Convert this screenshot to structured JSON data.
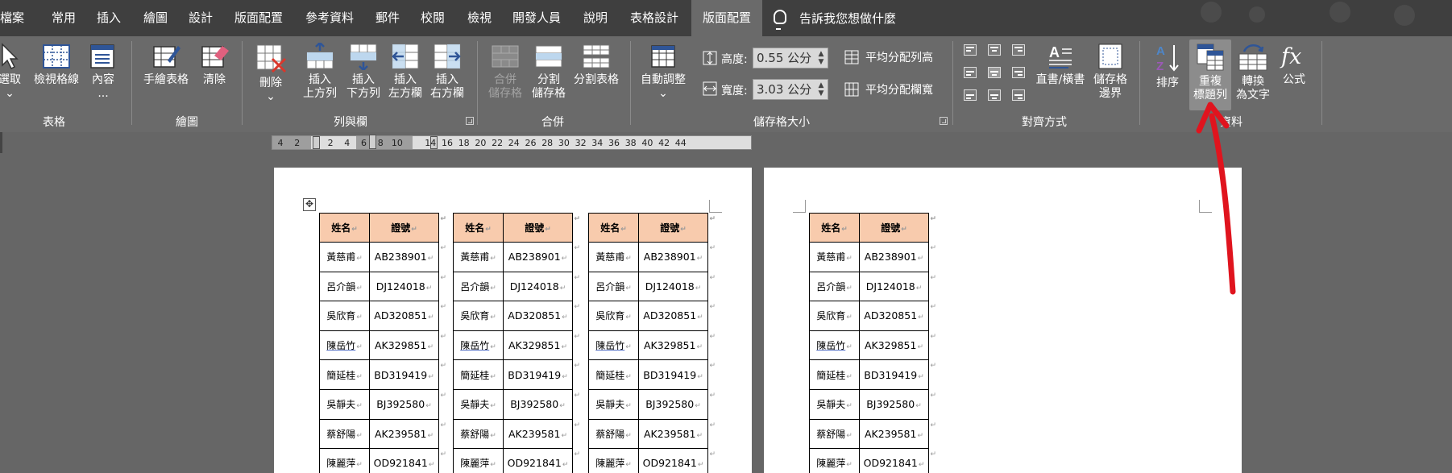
{
  "tabs": [
    {
      "label": "檔案",
      "active": false
    },
    {
      "label": "常用",
      "active": false
    },
    {
      "label": "插入",
      "active": false
    },
    {
      "label": "繪圖",
      "active": false
    },
    {
      "label": "設計",
      "active": false
    },
    {
      "label": "版面配置",
      "active": false
    },
    {
      "label": "參考資料",
      "active": false
    },
    {
      "label": "郵件",
      "active": false
    },
    {
      "label": "校閱",
      "active": false
    },
    {
      "label": "檢視",
      "active": false
    },
    {
      "label": "開發人員",
      "active": false
    },
    {
      "label": "說明",
      "active": false
    },
    {
      "label": "表格設計",
      "active": false
    },
    {
      "label": "版面配置",
      "active": true
    }
  ],
  "tell_me": "告訴我您想做什麼",
  "ribbon": {
    "groups": {
      "table": "表格",
      "draw": "繪圖",
      "rows_cols": "列與欄",
      "merge": "合併",
      "cell_size": "儲存格大小",
      "alignment": "對齊方式",
      "data": "資料"
    },
    "buttons": {
      "select": "選取",
      "view_gridlines": "檢視格線",
      "properties": "內容",
      "draw_table": "手繪表格",
      "eraser": "清除",
      "delete": "刪除",
      "insert_above_1": "插入",
      "insert_above_2": "上方列",
      "insert_below_1": "插入",
      "insert_below_2": "下方列",
      "insert_left_1": "插入",
      "insert_left_2": "左方欄",
      "insert_right_1": "插入",
      "insert_right_2": "右方欄",
      "merge_cells_1": "合併",
      "merge_cells_2": "儲存格",
      "split_cells_1": "分割",
      "split_cells_2": "儲存格",
      "split_table": "分割表格",
      "autofit": "自動調整",
      "height_label": "高度:",
      "height_value": "0.55 公分",
      "width_label": "寬度:",
      "width_value": "3.03 公分",
      "distribute_rows": "平均分配列高",
      "distribute_cols": "平均分配欄寬",
      "text_direction": "直書/橫書",
      "cell_margins_1": "儲存格",
      "cell_margins_2": "邊界",
      "sort": "排序",
      "repeat_header_1": "重複",
      "repeat_header_2": "標題列",
      "convert_1": "轉換",
      "convert_2": "為文字",
      "formula": "公式"
    }
  },
  "ruler_numbers": [
    "4",
    "2",
    "",
    "2",
    "4",
    "6",
    "8",
    "10",
    "",
    "14",
    "16",
    "18",
    "20",
    "22",
    "24",
    "26",
    "28",
    "30",
    "32",
    "34",
    "36",
    "38",
    "40",
    "42",
    "44"
  ],
  "table": {
    "header": [
      "姓名",
      "證號"
    ],
    "rows": [
      [
        "黃慈甫",
        "AB238901"
      ],
      [
        "呂介韻",
        "DJ124018"
      ],
      [
        "吳欣育",
        "AD320851"
      ],
      [
        "陳岳竹",
        "AK329851"
      ],
      [
        "簡延桂",
        "BD319419"
      ],
      [
        "吳靜夫",
        "BJ392580"
      ],
      [
        "蔡舒陽",
        "AK239581"
      ],
      [
        "陳麗萍",
        "OD921841"
      ]
    ]
  }
}
